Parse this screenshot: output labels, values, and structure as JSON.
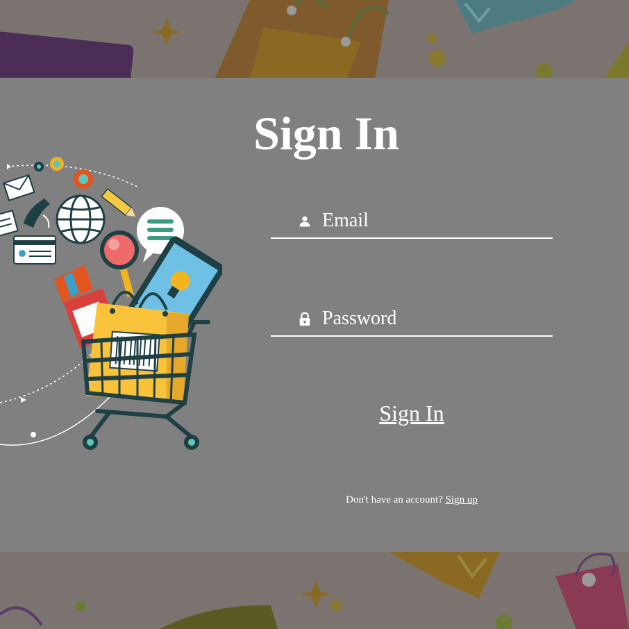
{
  "form": {
    "title": "Sign In",
    "email_placeholder": "Email",
    "password_placeholder": "Password",
    "submit_label": "Sign In",
    "signup_prompt": "Don't have an account?",
    "signup_link": "Sign up"
  },
  "icons": {
    "email": "person-icon",
    "password": "lock-icon"
  },
  "colors": {
    "panel": "#808080",
    "text": "#ffffff",
    "background": "#7a7370"
  }
}
